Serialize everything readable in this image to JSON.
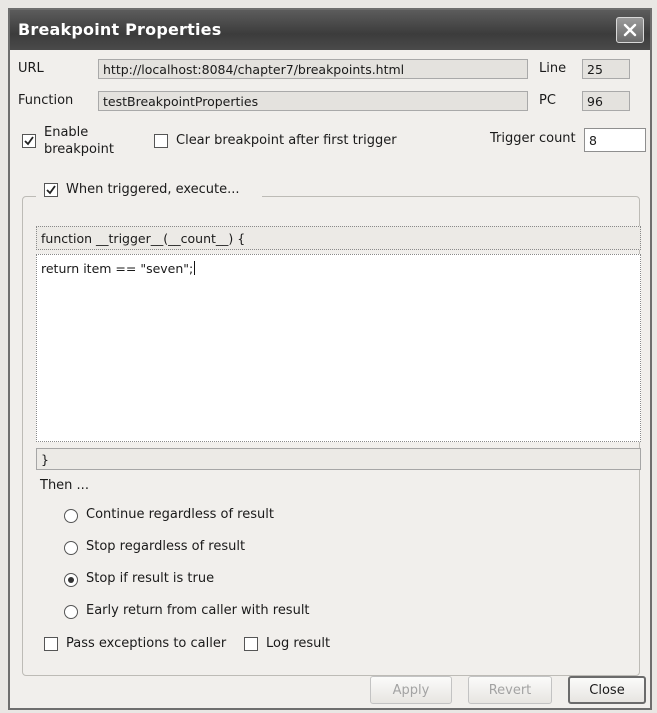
{
  "window": {
    "title": "Breakpoint Properties"
  },
  "url": {
    "label": "URL",
    "value": "http://localhost:8084/chapter7/breakpoints.html"
  },
  "line": {
    "label": "Line",
    "value": "25"
  },
  "function": {
    "label": "Function",
    "value": "testBreakpointProperties"
  },
  "pc": {
    "label": "PC",
    "value": "96"
  },
  "enable_breakpoint": {
    "label_line1": "Enable",
    "label_line2": "breakpoint",
    "checked": true
  },
  "clear_after_first": {
    "label": "Clear breakpoint after first trigger",
    "checked": false
  },
  "trigger_count": {
    "label": "Trigger count",
    "value": "8"
  },
  "when_triggered": {
    "label": "When triggered, execute...",
    "checked": true
  },
  "code": {
    "header": "function __trigger__(__count__) {",
    "body": "return item == \"seven\";",
    "footer": "}"
  },
  "then": {
    "label": "Then ...",
    "options": [
      {
        "label": "Continue regardless of result",
        "selected": false
      },
      {
        "label": "Stop regardless of result",
        "selected": false
      },
      {
        "label": "Stop if result is true",
        "selected": true
      },
      {
        "label": "Early return from caller with result",
        "selected": false
      }
    ]
  },
  "pass_exceptions": {
    "label": "Pass exceptions to caller",
    "checked": false
  },
  "log_result": {
    "label": "Log result",
    "checked": false
  },
  "buttons": {
    "apply": "Apply",
    "revert": "Revert",
    "close": "Close"
  },
  "icons": {
    "close": "close-icon",
    "check": "check-icon"
  },
  "colors": {
    "titlebar": "#4a4a4a",
    "window_bg": "#f1efec"
  }
}
